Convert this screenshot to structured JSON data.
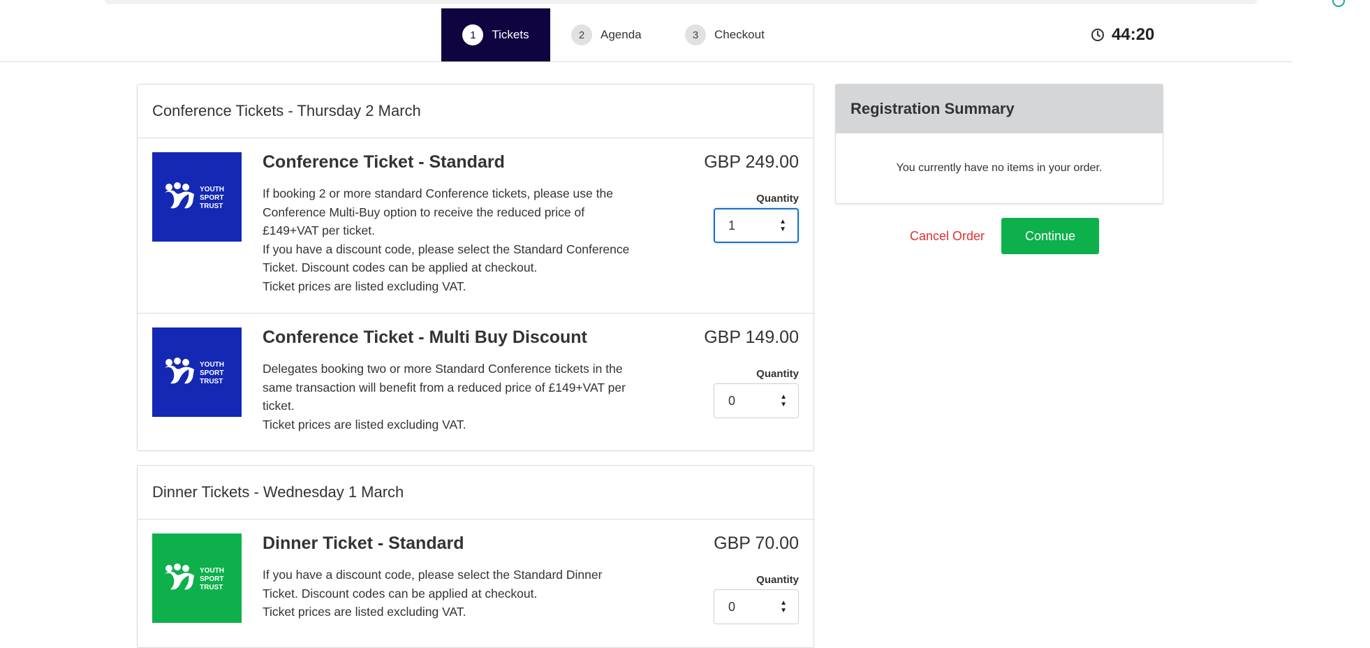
{
  "steps": [
    {
      "number": "1",
      "label": "Tickets",
      "active": true
    },
    {
      "number": "2",
      "label": "Agenda",
      "active": false
    },
    {
      "number": "3",
      "label": "Checkout",
      "active": false
    }
  ],
  "timer": {
    "value": "44:20",
    "icon": "clock-icon"
  },
  "logo": {
    "text_lines": [
      "YOUTH",
      "SPORT",
      "TRUST"
    ]
  },
  "sections": [
    {
      "title": "Conference Tickets - Thursday 2 March",
      "tickets": [
        {
          "name": "Conference Ticket - Standard",
          "price": "GBP 249.00",
          "quantity_label": "Quantity",
          "quantity": "1",
          "logo_color": "#1428b4",
          "description": [
            "If booking 2 or more standard Conference tickets, please use the",
            "Conference Multi-Buy option to receive the reduced price of",
            "£149+VAT per ticket.",
            "If you have a discount code, please select the Standard Conference",
            "Ticket. Discount codes can be applied at checkout.",
            "Ticket prices are listed excluding VAT."
          ]
        },
        {
          "name": "Conference Ticket - Multi Buy Discount",
          "price": "GBP 149.00",
          "quantity_label": "Quantity",
          "quantity": "0",
          "logo_color": "#1428b4",
          "description": [
            "Delegates booking two or more Standard Conference tickets in the",
            "same transaction will benefit from a reduced price of £149+VAT per",
            "ticket.",
            "Ticket prices are listed excluding VAT."
          ]
        }
      ]
    },
    {
      "title": "Dinner Tickets - Wednesday 1 March",
      "tickets": [
        {
          "name": "Dinner Ticket - Standard",
          "price": "GBP 70.00",
          "quantity_label": "Quantity",
          "quantity": "0",
          "logo_color": "#0db04b",
          "description": [
            "If you have a discount code, please select the Standard Dinner",
            "Ticket. Discount codes can be applied at checkout.",
            "Ticket prices are listed excluding VAT."
          ]
        }
      ]
    }
  ],
  "summary": {
    "title": "Registration Summary",
    "empty_message": "You currently have no items in your order."
  },
  "actions": {
    "cancel_label": "Cancel Order",
    "continue_label": "Continue"
  },
  "colors": {
    "nav_active": "#0f0440",
    "primary_button": "#0db04b",
    "cancel_text": "#e0302e",
    "summary_header": "#d5d6d8"
  }
}
